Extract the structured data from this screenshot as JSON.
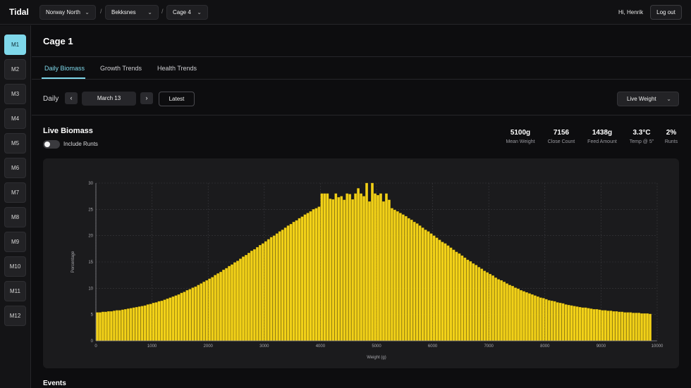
{
  "header": {
    "brand": "Tidal",
    "breadcrumbs": [
      {
        "label": "Norway North"
      },
      {
        "label": "Bekksnes"
      },
      {
        "label": "Cage 4"
      }
    ],
    "separator": "/",
    "greeting": "Hi, Henrik",
    "logout_label": "Log out"
  },
  "sidebar": {
    "items": [
      {
        "label": "M1",
        "active": true
      },
      {
        "label": "M2"
      },
      {
        "label": "M3"
      },
      {
        "label": "M4"
      },
      {
        "label": "M5"
      },
      {
        "label": "M6"
      },
      {
        "label": "M7"
      },
      {
        "label": "M8"
      },
      {
        "label": "M9"
      },
      {
        "label": "M10"
      },
      {
        "label": "M11"
      },
      {
        "label": "M12"
      }
    ]
  },
  "page": {
    "title": "Cage 1"
  },
  "tabs": [
    {
      "label": "Daily Biomass",
      "active": true
    },
    {
      "label": "Growth Trends"
    },
    {
      "label": "Health Trends"
    }
  ],
  "controls": {
    "period_label": "Daily",
    "prev_icon": "‹",
    "next_icon": "›",
    "date": "March 13",
    "latest_label": "Latest",
    "metric_select": "Live Weight"
  },
  "section": {
    "title": "Live Biomass",
    "toggle_label": "Include Runts",
    "toggle_on": false
  },
  "stats": [
    {
      "value": "5100g",
      "label": "Mean Weight"
    },
    {
      "value": "7156",
      "label": "Close Count"
    },
    {
      "value": "1438g",
      "label": "Feed Amount"
    },
    {
      "value": "3.3°C",
      "label": "Temp @ 5\""
    },
    {
      "value": "2%",
      "label": "Runts"
    }
  ],
  "events_title": "Events",
  "colors": {
    "accent": "#7fd8ea",
    "bar": "#f2d118",
    "background": "#0d0d0f",
    "panel": "#1b1b1d"
  },
  "chart_data": {
    "type": "bar",
    "xlabel": "Weight (g)",
    "ylabel": "Percentage",
    "xlim": [
      0,
      10000
    ],
    "ylim": [
      0,
      30
    ],
    "xticks": [
      0,
      1000,
      2000,
      3000,
      4000,
      5000,
      6000,
      7000,
      8000,
      9000,
      10000
    ],
    "yticks": [
      0,
      5,
      10,
      15,
      20,
      25,
      30
    ],
    "grid": true,
    "bin_width": 50,
    "x": [
      25,
      75,
      125,
      175,
      225,
      275,
      325,
      375,
      425,
      475,
      525,
      575,
      625,
      675,
      725,
      775,
      825,
      875,
      925,
      975,
      1025,
      1075,
      1125,
      1175,
      1225,
      1275,
      1325,
      1375,
      1425,
      1475,
      1525,
      1575,
      1625,
      1675,
      1725,
      1775,
      1825,
      1875,
      1925,
      1975,
      2025,
      2075,
      2125,
      2175,
      2225,
      2275,
      2325,
      2375,
      2425,
      2475,
      2525,
      2575,
      2625,
      2675,
      2725,
      2775,
      2825,
      2875,
      2925,
      2975,
      3025,
      3075,
      3125,
      3175,
      3225,
      3275,
      3325,
      3375,
      3425,
      3475,
      3525,
      3575,
      3625,
      3675,
      3725,
      3775,
      3825,
      3875,
      3925,
      3975,
      4025,
      4075,
      4125,
      4175,
      4225,
      4275,
      4325,
      4375,
      4425,
      4475,
      4525,
      4575,
      4625,
      4675,
      4725,
      4775,
      4825,
      4875,
      4925,
      4975,
      5025,
      5075,
      5125,
      5175,
      5225,
      5275,
      5325,
      5375,
      5425,
      5475,
      5525,
      5575,
      5625,
      5675,
      5725,
      5775,
      5825,
      5875,
      5925,
      5975,
      6025,
      6075,
      6125,
      6175,
      6225,
      6275,
      6325,
      6375,
      6425,
      6475,
      6525,
      6575,
      6625,
      6675,
      6725,
      6775,
      6825,
      6875,
      6925,
      6975,
      7025,
      7075,
      7125,
      7175,
      7225,
      7275,
      7325,
      7375,
      7425,
      7475,
      7525,
      7575,
      7625,
      7675,
      7725,
      7775,
      7825,
      7875,
      7925,
      7975,
      8025,
      8075,
      8125,
      8175,
      8225,
      8275,
      8325,
      8375,
      8425,
      8475,
      8525,
      8575,
      8625,
      8675,
      8725,
      8775,
      8825,
      8875,
      8925,
      8975,
      9025,
      9075,
      9125,
      9175,
      9225,
      9275,
      9325,
      9375,
      9425,
      9475,
      9525,
      9575,
      9625,
      9675,
      9725,
      9775,
      9825,
      9875,
      9925,
      9975
    ],
    "values": [
      5.4,
      5.4,
      5.5,
      5.5,
      5.6,
      5.6,
      5.7,
      5.8,
      5.8,
      5.9,
      6,
      6.1,
      6.2,
      6.3,
      6.4,
      6.5,
      6.6,
      6.7,
      6.9,
      7,
      7.2,
      7.3,
      7.5,
      7.6,
      7.8,
      8,
      8.2,
      8.4,
      8.6,
      8.8,
      9.1,
      9.3,
      9.6,
      9.8,
      10.1,
      10.3,
      10.6,
      10.9,
      11.2,
      11.5,
      11.8,
      12.1,
      12.5,
      12.8,
      13.1,
      13.5,
      13.8,
      14.2,
      14.5,
      14.9,
      15.2,
      15.6,
      16,
      16.3,
      16.7,
      17.1,
      17.4,
      17.8,
      18.2,
      18.5,
      18.9,
      19.3,
      19.7,
      20,
      20.4,
      20.8,
      21.1,
      21.5,
      21.9,
      22.2,
      22.6,
      22.9,
      23.3,
      23.6,
      24,
      24.3,
      24.6,
      25,
      25.2,
      25.5,
      28,
      28,
      28,
      27,
      26.9,
      28,
      27.3,
      27.5,
      26.8,
      28,
      27.9,
      26.9,
      28,
      29,
      28,
      27.5,
      30,
      26.5,
      30,
      28,
      27.7,
      28,
      26.5,
      28,
      26.8,
      25.2,
      24.9,
      24.6,
      24.3,
      24,
      23.7,
      23.3,
      23,
      22.6,
      22.3,
      21.9,
      21.5,
      21.1,
      20.8,
      20.4,
      20,
      19.6,
      19.2,
      18.8,
      18.5,
      18.1,
      17.7,
      17.3,
      16.9,
      16.6,
      16.2,
      15.8,
      15.4,
      15.1,
      14.7,
      14.4,
      14,
      13.7,
      13.3,
      13,
      12.7,
      12.4,
      12,
      11.7,
      11.5,
      11.2,
      10.9,
      10.6,
      10.4,
      10.1,
      9.9,
      9.6,
      9.4,
      9.2,
      9,
      8.8,
      8.6,
      8.4,
      8.2,
      8.1,
      7.9,
      7.7,
      7.6,
      7.5,
      7.3,
      7.2,
      7.1,
      6.9,
      6.8,
      6.7,
      6.6,
      6.5,
      6.4,
      6.3,
      6.3,
      6.2,
      6.1,
      6,
      6,
      5.9,
      5.8,
      5.8,
      5.7,
      5.7,
      5.6,
      5.6,
      5.5,
      5.5,
      5.4,
      5.4,
      5.4,
      5.3,
      5.3,
      5.3,
      5.2,
      5.2,
      5.2,
      5.1
    ]
  }
}
